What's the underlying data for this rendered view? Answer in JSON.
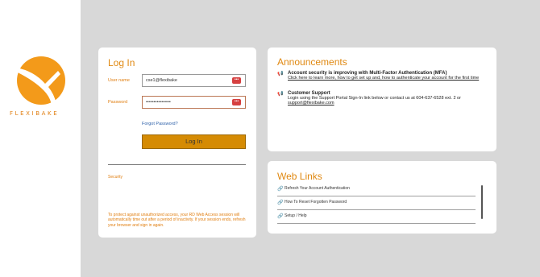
{
  "brand": {
    "name": "FLEXIBAKE",
    "accent": "#e07e10"
  },
  "login": {
    "title": "Log In",
    "username_label": "User name",
    "username_value": "cse1@flexibake",
    "password_label": "Password",
    "password_value": "••••••••••••••••",
    "forgot_label": "Forgot Password?",
    "button_label": "Log In",
    "security_label": "Security",
    "security_text": "To protect against unauthorized access, your RD Web Access session will automatically time out after a period of inactivity. If your session ends, refresh your browser and sign in again."
  },
  "announcements": {
    "title": "Announcements",
    "items": [
      {
        "heading": "Account security is improving with Multi-Factor Authentication (MFA)",
        "link": "Click here to learn more, how to get set up and, how to authenticate your account for the first time"
      },
      {
        "heading": "Customer Support",
        "text": "Login using the Support Portal Sign-In link below or contact us at 604-637-6528 ext. 2 or",
        "link": "support@flexibake.com"
      }
    ]
  },
  "web_links": {
    "title": "Web Links",
    "items": [
      {
        "label": "Refresh Your Account Authentication"
      },
      {
        "label": "How To Reset Forgotten Password"
      },
      {
        "label": "Setup / Help"
      }
    ]
  }
}
